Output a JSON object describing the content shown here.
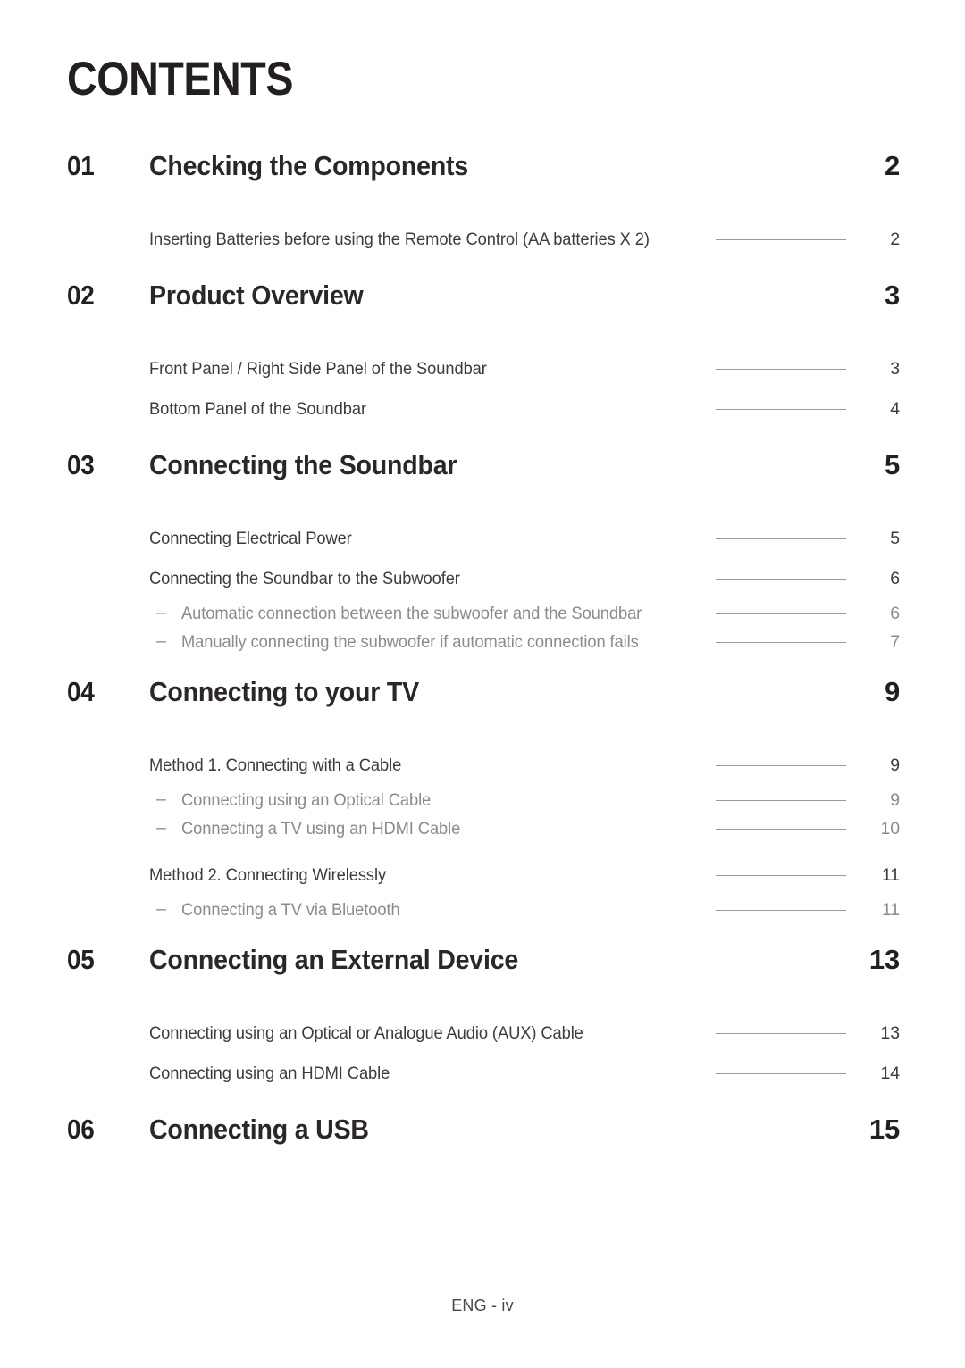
{
  "page": {
    "heading": "CONTENTS",
    "footer": "ENG - iv"
  },
  "toc": {
    "sections": [
      {
        "number": "01",
        "title": "Checking the Components",
        "page": "2",
        "entries": [
          {
            "label": "Inserting Batteries before using the Remote Control (AA batteries X 2)",
            "page": "2",
            "level": 2
          }
        ]
      },
      {
        "number": "02",
        "title": "Product Overview",
        "page": "3",
        "entries": [
          {
            "label": "Front Panel / Right Side Panel of the Soundbar",
            "page": "3",
            "level": 2
          },
          {
            "label": "Bottom Panel of the Soundbar",
            "page": "4",
            "level": 2
          }
        ]
      },
      {
        "number": "03",
        "title": "Connecting the Soundbar",
        "page": "5",
        "entries": [
          {
            "label": "Connecting Electrical Power",
            "page": "5",
            "level": 2
          },
          {
            "label": "Connecting the Soundbar to the Subwoofer",
            "page": "6",
            "level": 2
          },
          {
            "label": "Automatic connection between the subwoofer and the Soundbar",
            "page": "6",
            "level": 3,
            "bullet": "–"
          },
          {
            "label": "Manually connecting the subwoofer if automatic connection fails",
            "page": "7",
            "level": 3,
            "bullet": "–"
          }
        ]
      },
      {
        "number": "04",
        "title": "Connecting to your TV",
        "page": "9",
        "entries": [
          {
            "label": "Method 1. Connecting with a Cable",
            "page": "9",
            "level": 2
          },
          {
            "label": "Connecting using an Optical Cable",
            "page": "9",
            "level": 3,
            "bullet": "–"
          },
          {
            "label": "Connecting a TV using an HDMI Cable",
            "page": "10",
            "level": 3,
            "bullet": "–"
          },
          {
            "label": "Method 2. Connecting Wirelessly",
            "page": "11",
            "level": 2
          },
          {
            "label": "Connecting a TV via Bluetooth",
            "page": "11",
            "level": 3,
            "bullet": "–"
          }
        ]
      },
      {
        "number": "05",
        "title": "Connecting an External Device",
        "page": "13",
        "entries": [
          {
            "label": "Connecting using an Optical or Analogue Audio (AUX) Cable",
            "page": "13",
            "level": 2
          },
          {
            "label": "Connecting using an HDMI Cable",
            "page": "14",
            "level": 2
          }
        ]
      },
      {
        "number": "06",
        "title": "Connecting a USB",
        "page": "15",
        "entries": []
      }
    ]
  },
  "colors": {
    "heading": "#231f20",
    "chapter_title": "#2b2726",
    "entry_text": "#3f3b3a",
    "subentry_text": "#8d8a89",
    "leader_line": "#9b9b9b",
    "background": "#ffffff"
  }
}
